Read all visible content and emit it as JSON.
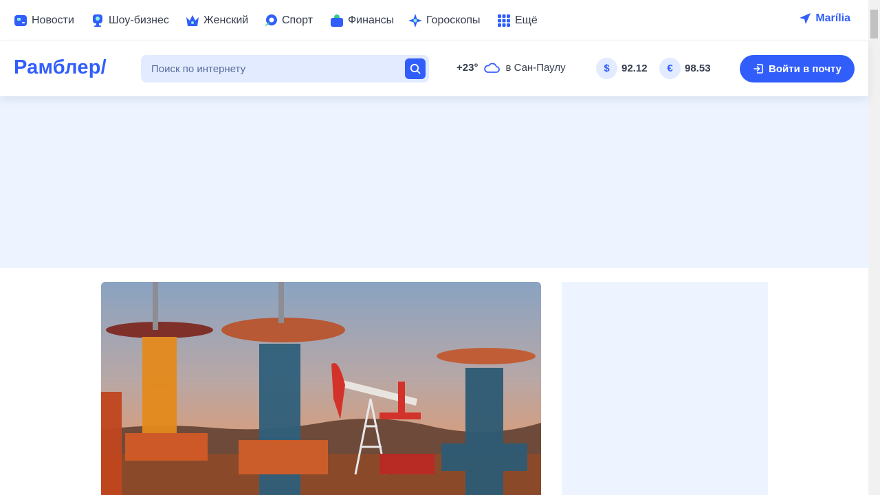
{
  "topnav": {
    "items": [
      {
        "label": "Новости",
        "icon": "news-icon",
        "color": "#315efb"
      },
      {
        "label": "Шоу-бизнес",
        "icon": "showbiz-icon",
        "color": "#315efb"
      },
      {
        "label": "Женский",
        "icon": "crown-icon",
        "color": "#315efb"
      },
      {
        "label": "Спорт",
        "icon": "sport-icon",
        "color": "#315efb"
      },
      {
        "label": "Финансы",
        "icon": "wallet-icon",
        "color": "#315efb"
      },
      {
        "label": "Гороскопы",
        "icon": "star-icon",
        "color": "#315efb"
      },
      {
        "label": "Ещё",
        "icon": "grid-icon",
        "color": "#315efb"
      }
    ],
    "location": "Marília"
  },
  "header": {
    "logo": "Рамблер/",
    "search": {
      "placeholder": "Поиск по интернету"
    },
    "weather": {
      "temp": "+23°",
      "city": "в Сан-Паулу"
    },
    "rates": [
      {
        "symbol": "$",
        "value": "92.12"
      },
      {
        "symbol": "€",
        "value": "98.53"
      }
    ],
    "login_label": "Войти в почту"
  },
  "colors": {
    "accent": "#315efb",
    "banner_bg": "#eef4ff",
    "text": "#343b4c"
  }
}
